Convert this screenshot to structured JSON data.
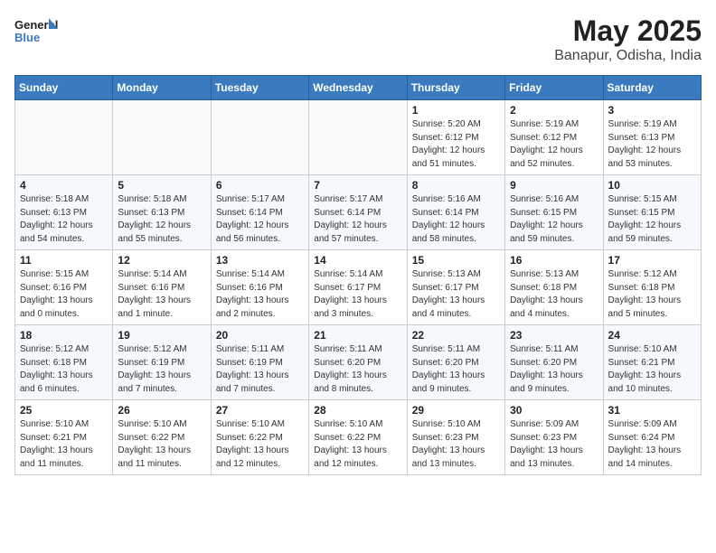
{
  "header": {
    "logo_line1": "General",
    "logo_line2": "Blue",
    "title": "May 2025",
    "subtitle": "Banapur, Odisha, India"
  },
  "weekdays": [
    "Sunday",
    "Monday",
    "Tuesday",
    "Wednesday",
    "Thursday",
    "Friday",
    "Saturday"
  ],
  "weeks": [
    [
      {
        "day": "",
        "info": ""
      },
      {
        "day": "",
        "info": ""
      },
      {
        "day": "",
        "info": ""
      },
      {
        "day": "",
        "info": ""
      },
      {
        "day": "1",
        "info": "Sunrise: 5:20 AM\nSunset: 6:12 PM\nDaylight: 12 hours\nand 51 minutes."
      },
      {
        "day": "2",
        "info": "Sunrise: 5:19 AM\nSunset: 6:12 PM\nDaylight: 12 hours\nand 52 minutes."
      },
      {
        "day": "3",
        "info": "Sunrise: 5:19 AM\nSunset: 6:13 PM\nDaylight: 12 hours\nand 53 minutes."
      }
    ],
    [
      {
        "day": "4",
        "info": "Sunrise: 5:18 AM\nSunset: 6:13 PM\nDaylight: 12 hours\nand 54 minutes."
      },
      {
        "day": "5",
        "info": "Sunrise: 5:18 AM\nSunset: 6:13 PM\nDaylight: 12 hours\nand 55 minutes."
      },
      {
        "day": "6",
        "info": "Sunrise: 5:17 AM\nSunset: 6:14 PM\nDaylight: 12 hours\nand 56 minutes."
      },
      {
        "day": "7",
        "info": "Sunrise: 5:17 AM\nSunset: 6:14 PM\nDaylight: 12 hours\nand 57 minutes."
      },
      {
        "day": "8",
        "info": "Sunrise: 5:16 AM\nSunset: 6:14 PM\nDaylight: 12 hours\nand 58 minutes."
      },
      {
        "day": "9",
        "info": "Sunrise: 5:16 AM\nSunset: 6:15 PM\nDaylight: 12 hours\nand 59 minutes."
      },
      {
        "day": "10",
        "info": "Sunrise: 5:15 AM\nSunset: 6:15 PM\nDaylight: 12 hours\nand 59 minutes."
      }
    ],
    [
      {
        "day": "11",
        "info": "Sunrise: 5:15 AM\nSunset: 6:16 PM\nDaylight: 13 hours\nand 0 minutes."
      },
      {
        "day": "12",
        "info": "Sunrise: 5:14 AM\nSunset: 6:16 PM\nDaylight: 13 hours\nand 1 minute."
      },
      {
        "day": "13",
        "info": "Sunrise: 5:14 AM\nSunset: 6:16 PM\nDaylight: 13 hours\nand 2 minutes."
      },
      {
        "day": "14",
        "info": "Sunrise: 5:14 AM\nSunset: 6:17 PM\nDaylight: 13 hours\nand 3 minutes."
      },
      {
        "day": "15",
        "info": "Sunrise: 5:13 AM\nSunset: 6:17 PM\nDaylight: 13 hours\nand 4 minutes."
      },
      {
        "day": "16",
        "info": "Sunrise: 5:13 AM\nSunset: 6:18 PM\nDaylight: 13 hours\nand 4 minutes."
      },
      {
        "day": "17",
        "info": "Sunrise: 5:12 AM\nSunset: 6:18 PM\nDaylight: 13 hours\nand 5 minutes."
      }
    ],
    [
      {
        "day": "18",
        "info": "Sunrise: 5:12 AM\nSunset: 6:18 PM\nDaylight: 13 hours\nand 6 minutes."
      },
      {
        "day": "19",
        "info": "Sunrise: 5:12 AM\nSunset: 6:19 PM\nDaylight: 13 hours\nand 7 minutes."
      },
      {
        "day": "20",
        "info": "Sunrise: 5:11 AM\nSunset: 6:19 PM\nDaylight: 13 hours\nand 7 minutes."
      },
      {
        "day": "21",
        "info": "Sunrise: 5:11 AM\nSunset: 6:20 PM\nDaylight: 13 hours\nand 8 minutes."
      },
      {
        "day": "22",
        "info": "Sunrise: 5:11 AM\nSunset: 6:20 PM\nDaylight: 13 hours\nand 9 minutes."
      },
      {
        "day": "23",
        "info": "Sunrise: 5:11 AM\nSunset: 6:20 PM\nDaylight: 13 hours\nand 9 minutes."
      },
      {
        "day": "24",
        "info": "Sunrise: 5:10 AM\nSunset: 6:21 PM\nDaylight: 13 hours\nand 10 minutes."
      }
    ],
    [
      {
        "day": "25",
        "info": "Sunrise: 5:10 AM\nSunset: 6:21 PM\nDaylight: 13 hours\nand 11 minutes."
      },
      {
        "day": "26",
        "info": "Sunrise: 5:10 AM\nSunset: 6:22 PM\nDaylight: 13 hours\nand 11 minutes."
      },
      {
        "day": "27",
        "info": "Sunrise: 5:10 AM\nSunset: 6:22 PM\nDaylight: 13 hours\nand 12 minutes."
      },
      {
        "day": "28",
        "info": "Sunrise: 5:10 AM\nSunset: 6:22 PM\nDaylight: 13 hours\nand 12 minutes."
      },
      {
        "day": "29",
        "info": "Sunrise: 5:10 AM\nSunset: 6:23 PM\nDaylight: 13 hours\nand 13 minutes."
      },
      {
        "day": "30",
        "info": "Sunrise: 5:09 AM\nSunset: 6:23 PM\nDaylight: 13 hours\nand 13 minutes."
      },
      {
        "day": "31",
        "info": "Sunrise: 5:09 AM\nSunset: 6:24 PM\nDaylight: 13 hours\nand 14 minutes."
      }
    ]
  ]
}
